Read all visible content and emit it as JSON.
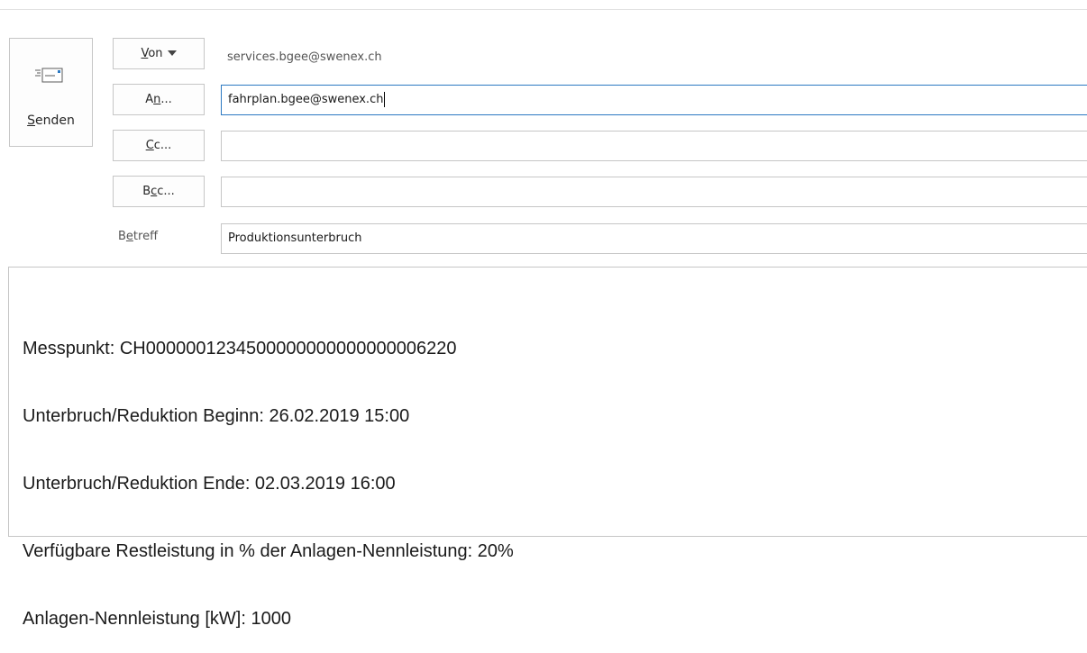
{
  "send": {
    "label_accel": "S",
    "label_rest": "enden",
    "icon": "send-mail-icon"
  },
  "from": {
    "button_accel": "V",
    "button_rest": "on",
    "value": "services.bgee@swenex.ch"
  },
  "to": {
    "button_pre": "A",
    "button_accel": "n",
    "button_post": "...",
    "value": "fahrplan.bgee@swenex.ch"
  },
  "cc": {
    "button_accel": "C",
    "button_rest": "c...",
    "value": ""
  },
  "bcc": {
    "button_pre": "B",
    "button_accel": "c",
    "button_post": "c...",
    "value": ""
  },
  "subject": {
    "label_pre": "B",
    "label_accel": "e",
    "label_post": "treff",
    "value": "Produktionsunterbruch"
  },
  "body": {
    "lines": [
      "Messpunkt: CH0000001234500000000000000006220",
      "Unterbruch/Reduktion Beginn: 26.02.2019 15:00",
      "Unterbruch/Reduktion Ende: 02.03.2019 16:00",
      "Verfügbare Restleistung in % der Anlagen-Nennleistung: 20%",
      "Anlagen-Nennleistung [kW]: 1000"
    ]
  }
}
